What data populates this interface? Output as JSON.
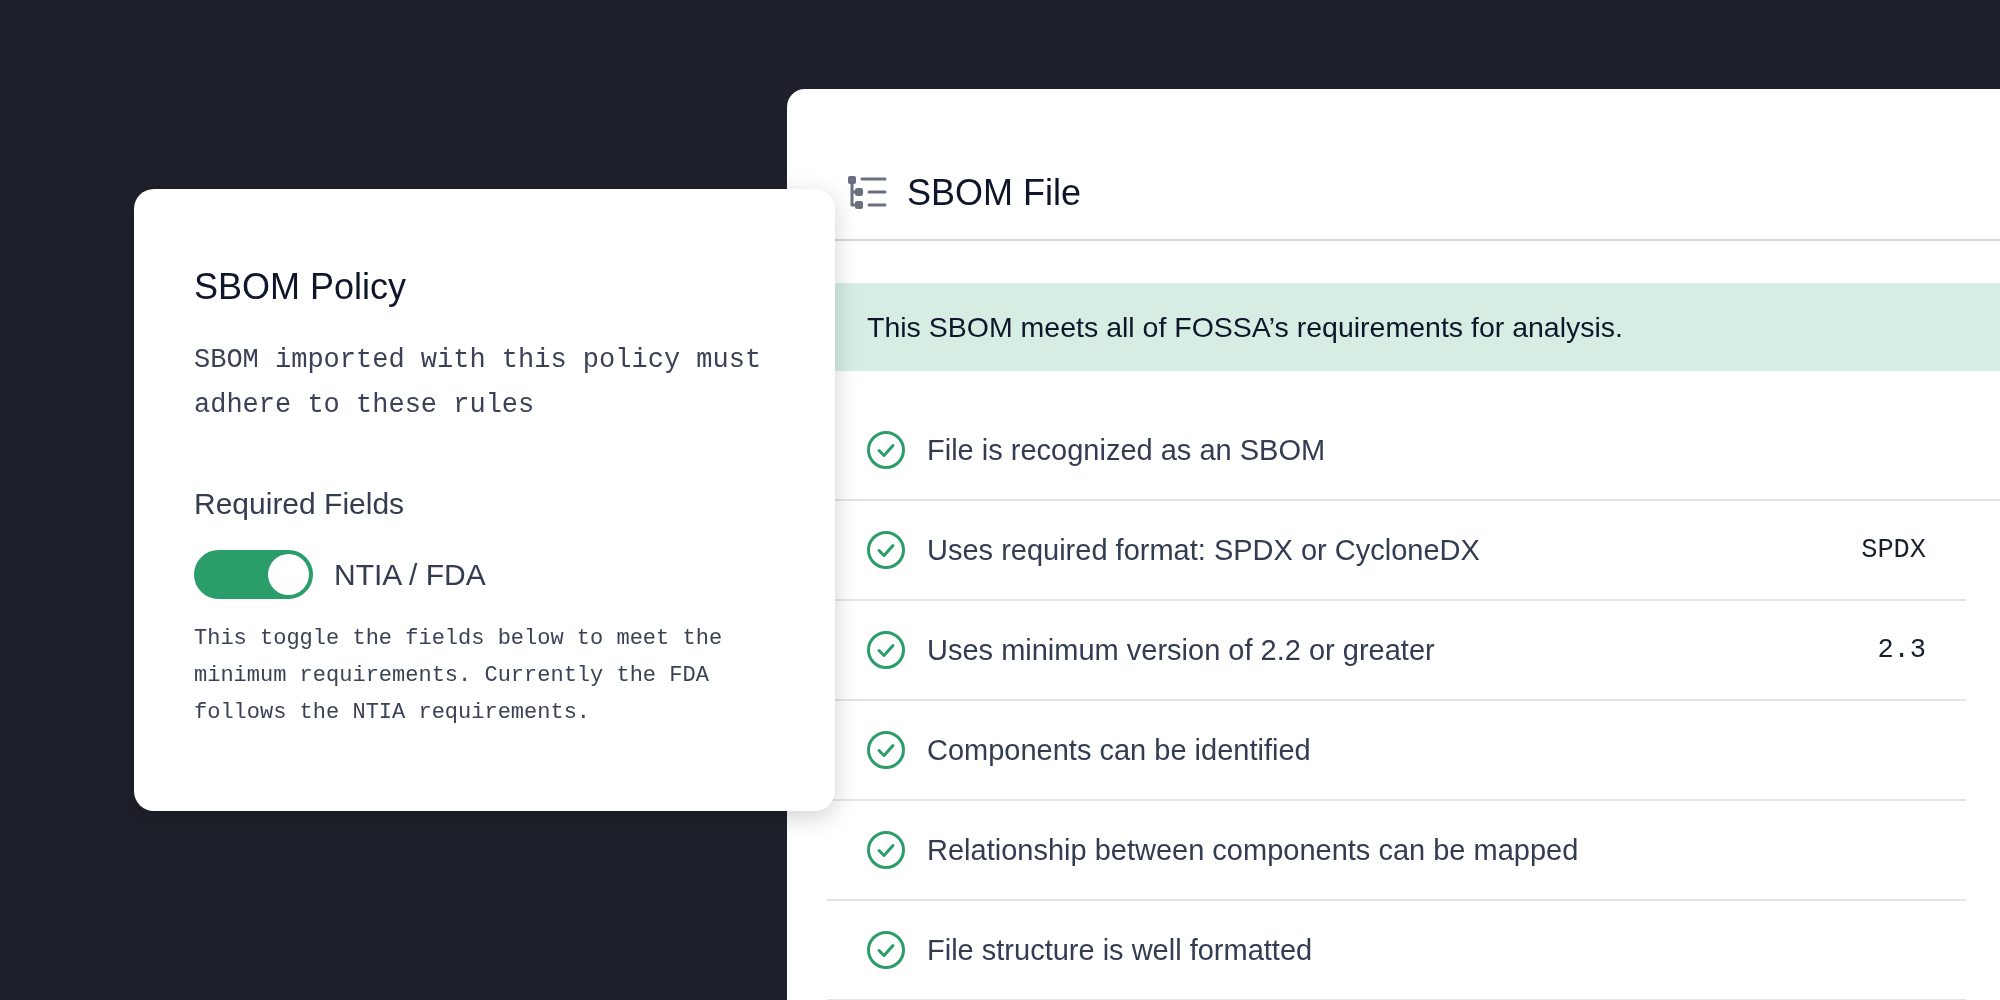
{
  "policy_card": {
    "title": "SBOM Policy",
    "description": "SBOM imported with this policy must adhere to these rules",
    "section_title": "Required Fields",
    "toggle": {
      "label": "NTIA / FDA",
      "on": true
    },
    "help_text": "This toggle the fields below to meet the minimum requirements. Currently the FDA follows the NTIA requirements."
  },
  "sbom_panel": {
    "title": "SBOM File",
    "banner": "This SBOM meets all of FOSSA’s requirements for analysis.",
    "checks": [
      {
        "label": "File is recognized as an SBOM",
        "passed": true
      },
      {
        "label": "Uses required format: SPDX or CycloneDX",
        "value": "SPDX",
        "passed": true
      },
      {
        "label": "Uses minimum version of 2.2 or greater",
        "value": "2.3",
        "passed": true
      },
      {
        "label": "Components can be identified",
        "passed": true
      },
      {
        "label": "Relationship between components can be mapped",
        "passed": true
      },
      {
        "label": "File structure is well formatted",
        "passed": true
      }
    ]
  }
}
